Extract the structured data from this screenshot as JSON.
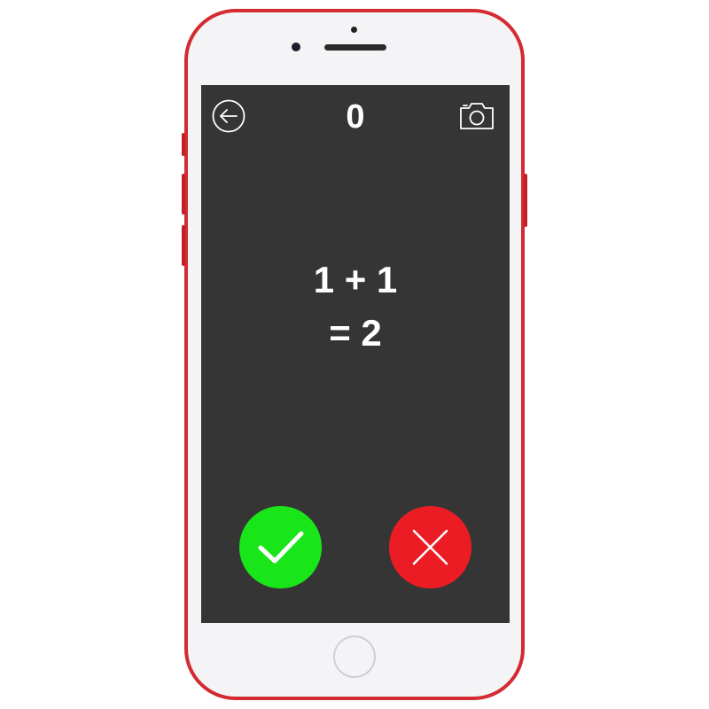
{
  "device": {
    "frame_color": "#d42b33",
    "screen_color": "#353535"
  },
  "header": {
    "back_icon": "arrow-left-circle-icon",
    "score": "0",
    "camera_icon": "camera-icon"
  },
  "equation": {
    "line1": "1 + 1",
    "line2": "= 2"
  },
  "answers": {
    "correct": {
      "icon": "checkmark-icon",
      "color": "#19e619"
    },
    "wrong": {
      "icon": "cross-icon",
      "color": "#ec1c24"
    }
  }
}
